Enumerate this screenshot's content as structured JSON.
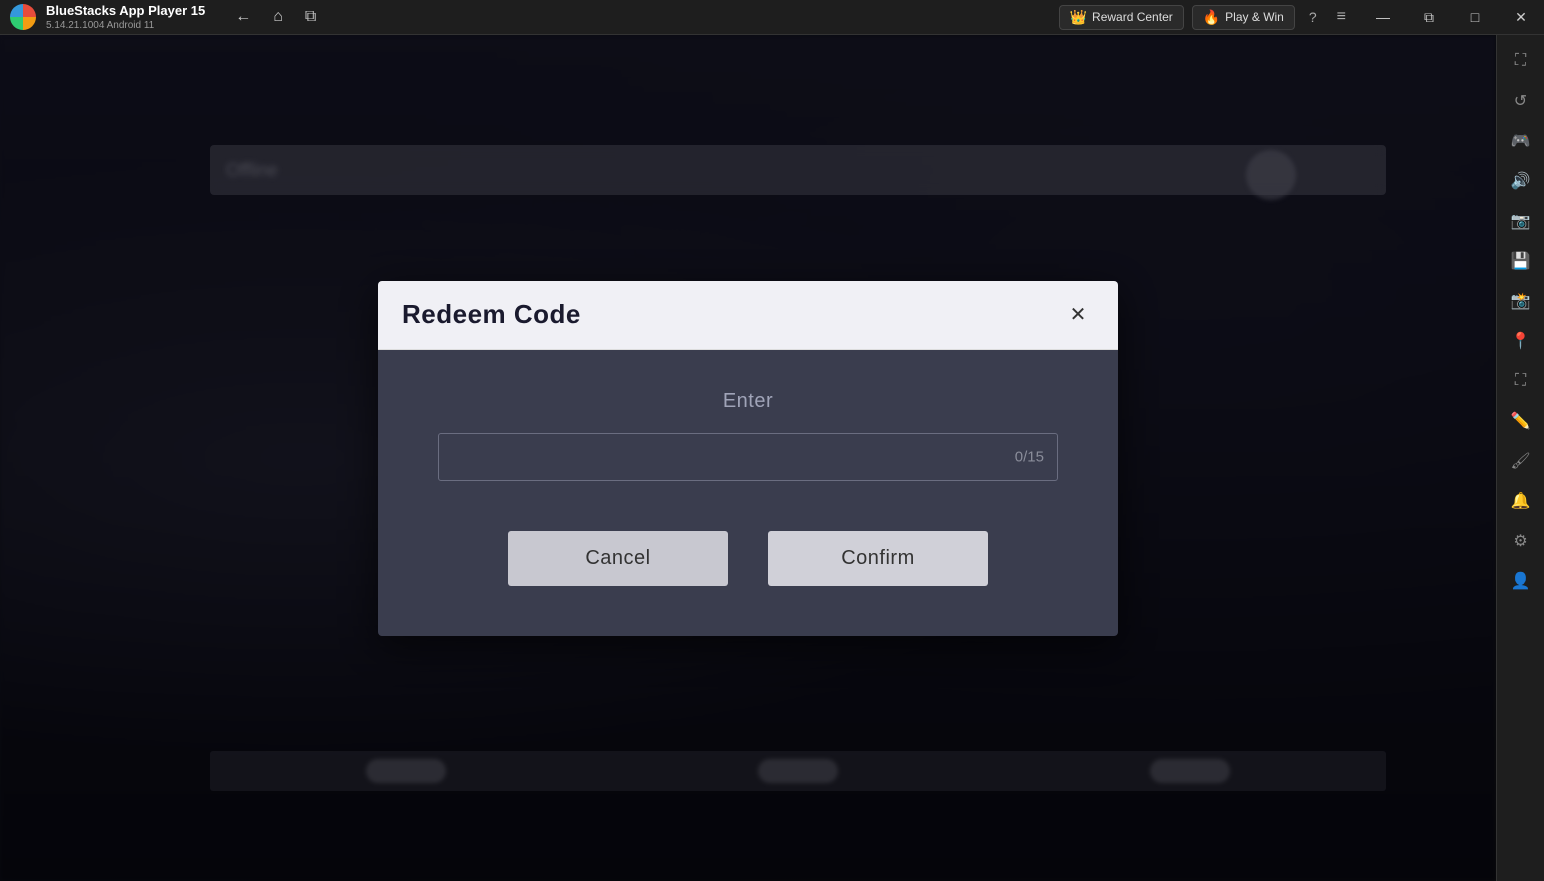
{
  "titlebar": {
    "app_name": "BlueStacks App Player 15",
    "version": "5.14.21.1004  Android 11",
    "nav": {
      "back_label": "←",
      "home_label": "⌂",
      "copy_label": "⧉"
    },
    "reward_center_label": "Reward Center",
    "play_win_label": "Play & Win",
    "help_label": "?",
    "menu_label": "≡",
    "minimize_label": "—",
    "maximize_label": "□",
    "close_label": "✕",
    "restore_label": "⧉"
  },
  "sidebar": {
    "icons": [
      {
        "name": "expand-icon",
        "glyph": "⛶"
      },
      {
        "name": "rotate-icon",
        "glyph": "↺"
      },
      {
        "name": "gamepad-icon",
        "glyph": "🎮"
      },
      {
        "name": "volume-icon",
        "glyph": "🔊"
      },
      {
        "name": "camera-icon",
        "glyph": "📷"
      },
      {
        "name": "storage-icon",
        "glyph": "💾"
      },
      {
        "name": "screenshot-icon",
        "glyph": "📸"
      },
      {
        "name": "location-icon",
        "glyph": "📍"
      },
      {
        "name": "fullscreen-icon",
        "glyph": "⛶"
      },
      {
        "name": "settings2-icon",
        "glyph": "✏️"
      },
      {
        "name": "brush-icon",
        "glyph": "🖌"
      },
      {
        "name": "notification-icon",
        "glyph": "🔔"
      },
      {
        "name": "gear-icon",
        "glyph": "⚙"
      },
      {
        "name": "person-icon",
        "glyph": "👤"
      }
    ]
  },
  "dialog": {
    "title": "Redeem Code",
    "close_label": "✕",
    "enter_label": "Enter",
    "input_placeholder": "",
    "input_counter": "0/15",
    "cancel_label": "Cancel",
    "confirm_label": "Confirm"
  },
  "backdrop": {
    "blurred_text": "Offline"
  },
  "colors": {
    "dialog_header_bg": "#f0f0f5",
    "dialog_body_bg": "#3a3d4e",
    "title_color": "#1a1a2e",
    "accent": "#3498db"
  }
}
